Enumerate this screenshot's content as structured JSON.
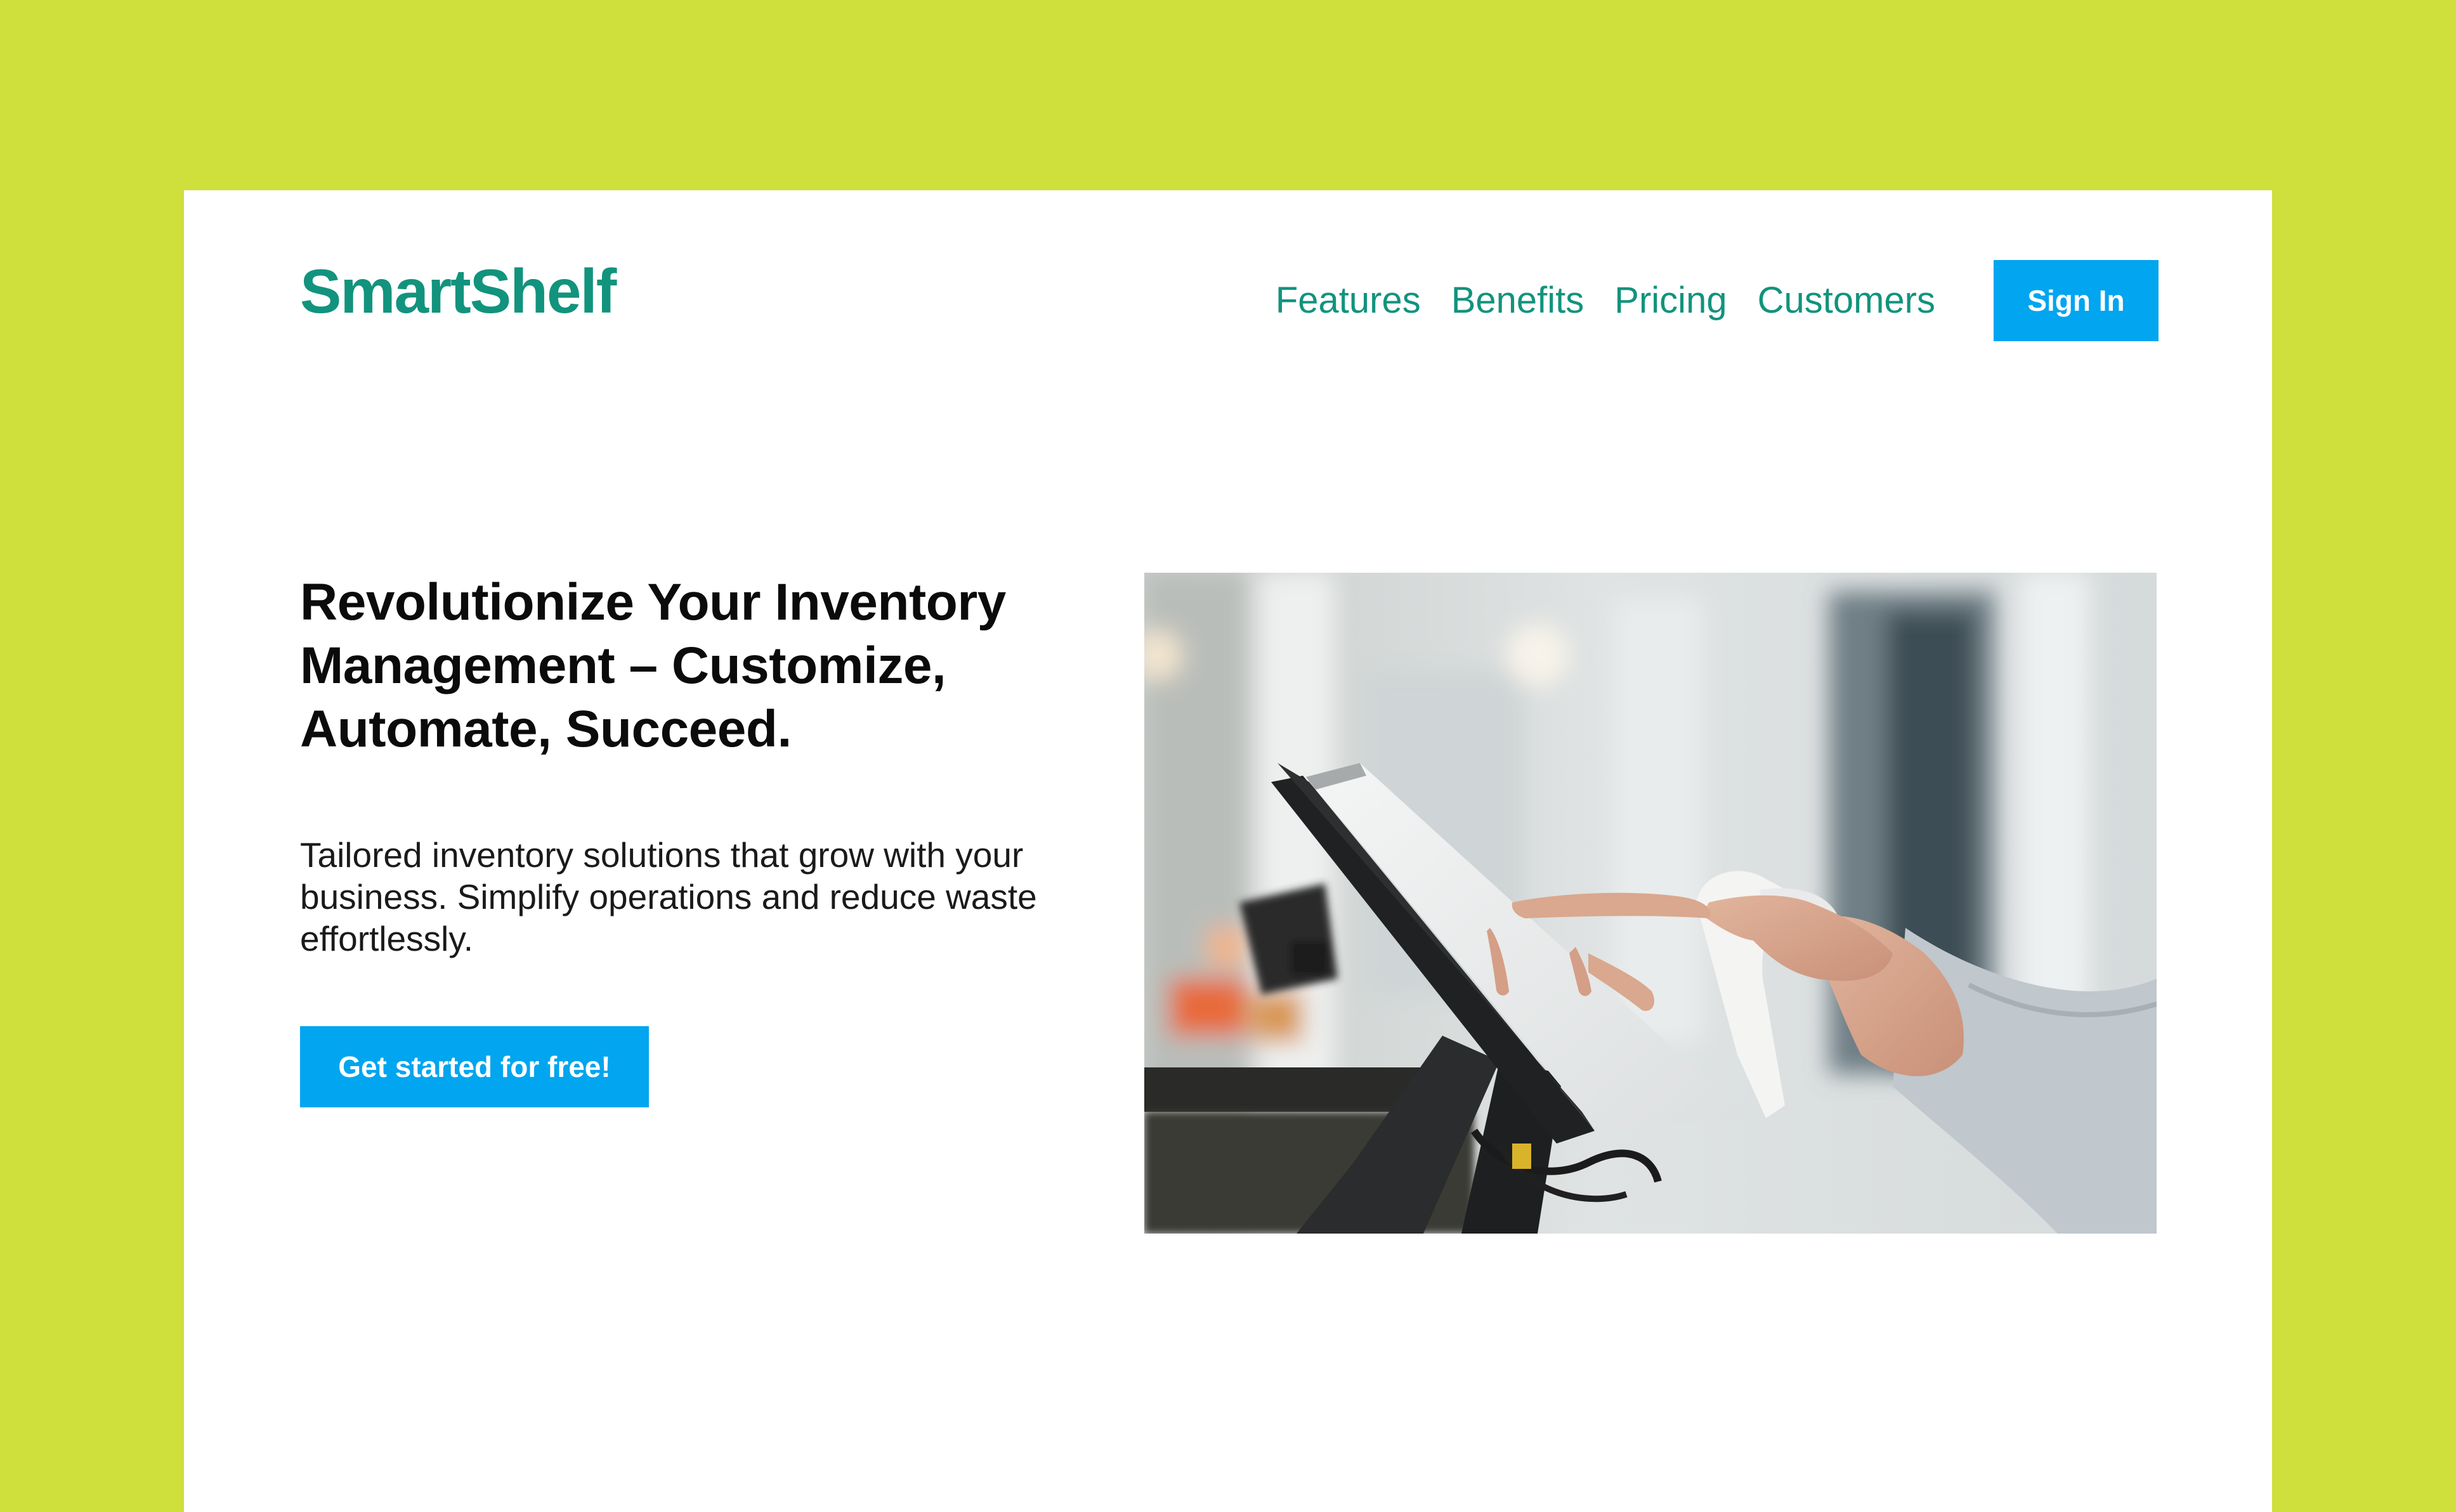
{
  "header": {
    "logo": "SmartShelf",
    "nav": [
      {
        "label": "Features"
      },
      {
        "label": "Benefits"
      },
      {
        "label": "Pricing"
      },
      {
        "label": "Customers"
      }
    ],
    "sign_in_label": "Sign In"
  },
  "hero": {
    "title": "Revolutionize Your Inventory Management – Customize, Automate, Succeed.",
    "subtitle": "Tailored inventory solutions that grow with your business. Simplify operations and reduce waste effortlessly.",
    "cta_label": "Get started for free!",
    "image_subject": "hands-using-pos-touchscreen"
  },
  "colors": {
    "background": "#cfdf3b",
    "card": "#ffffff",
    "brand": "#12937d",
    "accent": "#02a5ef",
    "heading": "#0b0b0b"
  }
}
